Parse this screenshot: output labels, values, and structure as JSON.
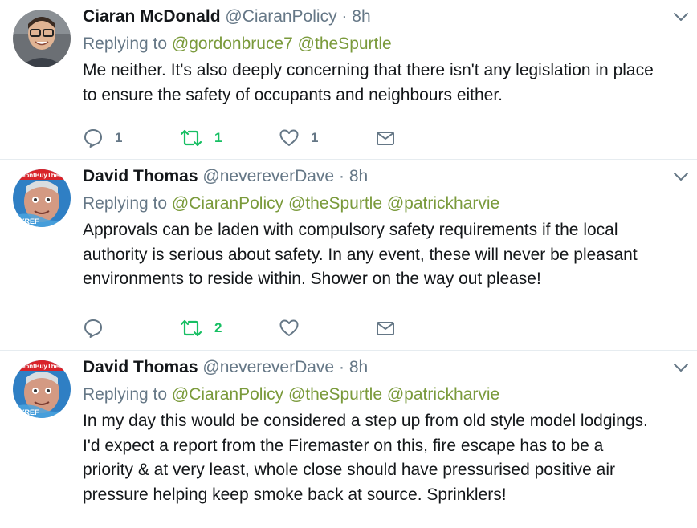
{
  "colors": {
    "link": "#7a9a3b",
    "muted": "#657786",
    "retweet": "#17bf63",
    "divider": "#e6ecf0"
  },
  "tweets": [
    {
      "name": "Ciaran McDonald",
      "handle": "@CiaranPolicy",
      "sep": "·",
      "time": "8h",
      "replying_label": "Replying to",
      "mentions": [
        "@gordonbruce7",
        "@theSpurtle"
      ],
      "text_lines": [
        "Me neither. It's also deeply concerning that there isn't any legislation in place",
        "to ensure the safety of occupants and neighbours either."
      ],
      "reply_count": "1",
      "retweet_count": "1",
      "like_count": "1"
    },
    {
      "name": "David Thomas",
      "handle": "@nevereverDave",
      "sep": "·",
      "time": "8h",
      "replying_label": "Replying to",
      "mentions": [
        "@CiaranPolicy",
        "@theSpurtle",
        "@patrickharvie"
      ],
      "text_lines": [
        "Approvals can be laden with compulsory safety requirements if the local",
        "authority is serious about safety.  In any event, these will never be pleasant",
        "environments to reside within. Shower on the way out please!"
      ],
      "reply_count": "",
      "retweet_count": "2",
      "like_count": ""
    },
    {
      "name": "David Thomas",
      "handle": "@nevereverDave",
      "sep": "·",
      "time": "8h",
      "replying_label": "Replying to",
      "mentions": [
        "@CiaranPolicy",
        "@theSpurtle",
        "@patrickharvie"
      ],
      "text_lines": [
        "In my day this would be considered a step up from old style model lodgings.",
        "I'd expect a report from the Firemaster on this, fire escape has to be a",
        "priority & at very least, whole close should have pressurised positive air",
        "pressure helping keep smoke back at source. Sprinklers!"
      ]
    }
  ],
  "icons": {
    "reply": "reply-icon",
    "retweet": "retweet-icon",
    "like": "heart-icon",
    "dm": "envelope-icon",
    "more": "chevron-down-icon"
  },
  "avatar_banner": {
    "top_text": "DontBuyTheS",
    "bottom_text": "BYREF"
  }
}
